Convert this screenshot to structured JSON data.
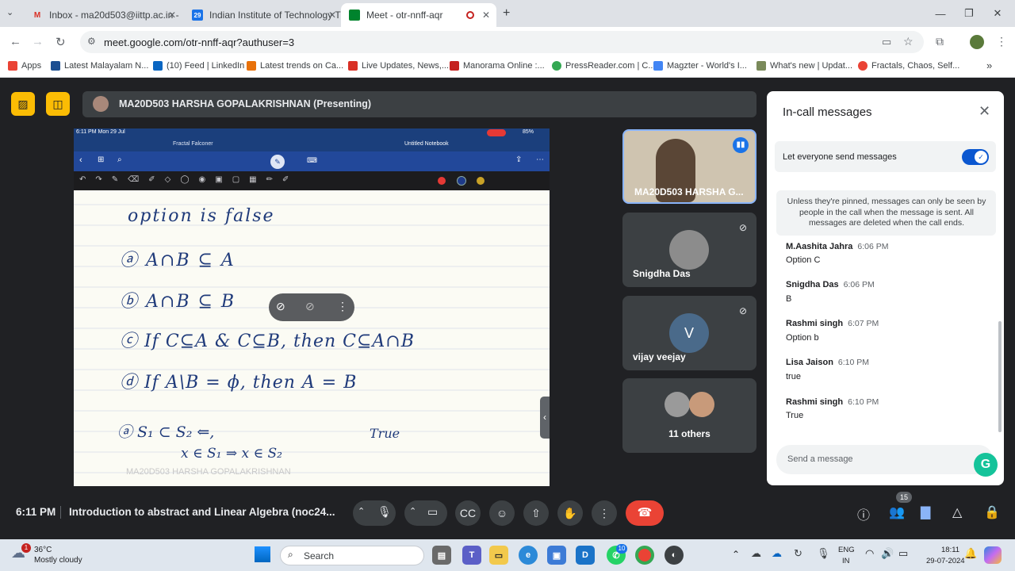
{
  "browser": {
    "tabs": [
      {
        "label": "Inbox - ma20d503@iittp.ac.in -",
        "icon": "gmail-icon"
      },
      {
        "label": "Indian Institute of Technology T",
        "icon": "calendar-icon"
      },
      {
        "label": "Meet - otr-nnff-aqr",
        "icon": "meet-icon"
      }
    ],
    "url": "meet.google.com/otr-nnff-aqr?authuser=3",
    "bookmarks": [
      "Apps",
      "Latest Malayalam N...",
      "(10) Feed | LinkedIn",
      "Latest trends on Ca...",
      "Live Updates, News,...",
      "Manorama Online :...",
      "PressReader.com | C...",
      "Magzter - World's I...",
      "What's new | Updat...",
      "Fractals, Chaos, Self..."
    ]
  },
  "presenting": {
    "label": "MA20D503 HARSHA GOPALAKRISHNAN (Presenting)"
  },
  "ipad": {
    "status_time": "6:11 PM  Mon 29 Jul",
    "battery": "85%",
    "tab_left": "Fractal Falconer",
    "tab_right": "Untitled Notebook",
    "watermark": "MA20D503 HARSHA GOPALAKRISHNAN",
    "notes": {
      "line1": "option is false",
      "a": "ⓐ  A∩B ⊆ A",
      "b": "ⓑ  A∩B ⊆ B",
      "c": "ⓒ  If  C⊆A & C⊆B,  then  C⊆A∩B",
      "d": "ⓓ  If  A\\B = ϕ,  then  A = B",
      "e1": "ⓐ    S₁ ⊂ S₂  ⇐,",
      "e2": "x ∈ S₁   ⇒   x ∈ S₂",
      "true": "True"
    }
  },
  "participants": [
    {
      "name": "MA20D503 HARSHA G..."
    },
    {
      "name": "Snigdha Das"
    },
    {
      "name": "vijay veejay",
      "initial": "V"
    },
    {
      "name": "11 others"
    }
  ],
  "chat": {
    "title": "In-call messages",
    "toggle_label": "Let everyone send messages",
    "notice": "Unless they're pinned, messages can only be seen by people in the call when the message is sent. All messages are deleted when the call ends.",
    "messages": [
      {
        "name": "M.Aashita Jahra",
        "time": "6:06 PM",
        "text": "Option C"
      },
      {
        "name": "Snigdha Das",
        "time": "6:06 PM",
        "text": "B"
      },
      {
        "name": "Rashmi singh",
        "time": "6:07 PM",
        "text": "Option b"
      },
      {
        "name": "Lisa Jaison",
        "time": "6:10 PM",
        "text": "true"
      },
      {
        "name": "Rashmi singh",
        "time": "6:10 PM",
        "text": "True"
      }
    ],
    "input_placeholder": "Send a message"
  },
  "footer": {
    "time": "6:11 PM",
    "meeting_title": "Introduction to abstract and Linear Algebra (noc24...",
    "people_count": "15"
  },
  "taskbar": {
    "weather_temp": "36°C",
    "weather_desc": "Mostly cloudy",
    "weather_badge": "1",
    "search": "Search",
    "whatsapp_badge": "10",
    "lang1": "ENG",
    "lang2": "IN",
    "clock_time": "18:11",
    "clock_date": "29-07-2024"
  }
}
